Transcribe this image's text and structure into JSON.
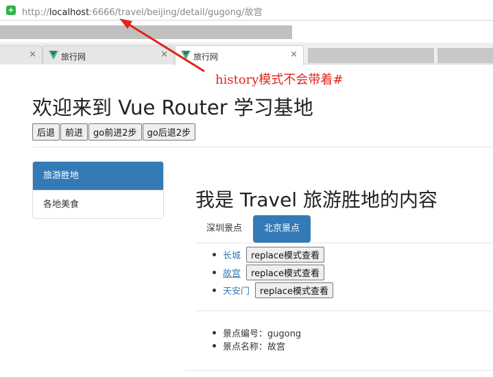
{
  "browser": {
    "url_prefix": "http://",
    "url_host": "localhost",
    "url_rest": ":6666/travel/beijing/detail/gugong/故宫",
    "secure_icon": "shield-check-icon",
    "tabs": [
      {
        "title": "",
        "close": "×",
        "active": false
      },
      {
        "title": "旅行网",
        "close": "×",
        "active": false,
        "icon": "vue-logo-icon"
      },
      {
        "title": "旅行网",
        "close": "×",
        "active": true,
        "icon": "vue-logo-icon"
      }
    ]
  },
  "annotation": {
    "text": "history模式不会带着#",
    "color": "#e0231b"
  },
  "page": {
    "title": "欢迎来到 Vue Router 学习基地",
    "nav_buttons": [
      "后退",
      "前进",
      "go前进2步",
      "go后退2步"
    ]
  },
  "sidebar": {
    "items": [
      {
        "label": "旅游胜地",
        "active": true
      },
      {
        "label": "各地美食",
        "active": false
      }
    ]
  },
  "content": {
    "title": "我是 Travel 旅游胜地的内容",
    "tabs": [
      {
        "label": "深圳景点",
        "active": false
      },
      {
        "label": "北京景点",
        "active": true
      }
    ],
    "spots": [
      {
        "name": "长城",
        "button": "replace模式查看"
      },
      {
        "name": "故宫",
        "button": "replace模式查看"
      },
      {
        "name": "天安门",
        "button": "replace模式查看"
      }
    ],
    "details": [
      "景点编号：gugong",
      "景点名称：故宫"
    ]
  },
  "colors": {
    "primary": "#337ab7",
    "annotation_red": "#e0231b",
    "secure_green": "#2fb24c"
  }
}
